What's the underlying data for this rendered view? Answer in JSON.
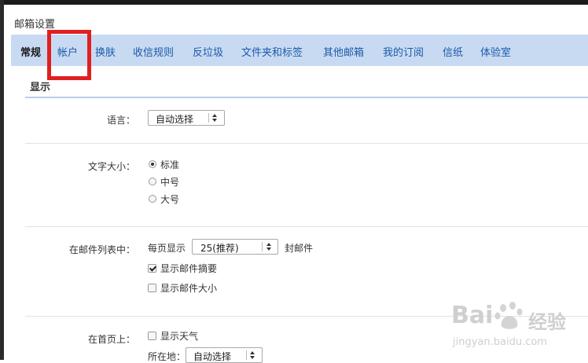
{
  "window": {
    "title": "邮箱设置"
  },
  "tabs": [
    {
      "label": "常规",
      "active": true
    },
    {
      "label": "帐户",
      "active": false
    },
    {
      "label": "换肤",
      "active": false
    },
    {
      "label": "收信规则",
      "active": false
    },
    {
      "label": "反垃圾",
      "active": false
    },
    {
      "label": "文件夹和标签",
      "active": false
    },
    {
      "label": "其他邮箱",
      "active": false
    },
    {
      "label": "我的订阅",
      "active": false
    },
    {
      "label": "信纸",
      "active": false
    },
    {
      "label": "体验室",
      "active": false
    }
  ],
  "section": {
    "title": "显示"
  },
  "language": {
    "label": "语言：",
    "select_value": "自动选择"
  },
  "font_size": {
    "label": "文字大小：",
    "options": [
      {
        "label": "标准",
        "checked": true
      },
      {
        "label": "中号",
        "checked": false
      },
      {
        "label": "大号",
        "checked": false
      }
    ]
  },
  "mail_list": {
    "label": "在邮件列表中：",
    "per_page_prefix": "每页显示",
    "per_page_value": "25(推荐)",
    "per_page_suffix": "封邮件",
    "show_summary": {
      "label": "显示邮件摘要",
      "checked": true
    },
    "show_size": {
      "label": "显示邮件大小",
      "checked": false
    }
  },
  "home_page": {
    "label": "在首页上：",
    "show_weather": {
      "label": "显示天气",
      "checked": false
    },
    "location_label": "所在地：",
    "location_value": "自动选择"
  },
  "watermark": {
    "brand": "Bai",
    "brand_suffix": "经验",
    "url": "jingyan.baidu.com"
  },
  "colors": {
    "tabbar": "#c8daf2",
    "tab_link": "#1b5aa8",
    "highlight": "#e02020"
  }
}
